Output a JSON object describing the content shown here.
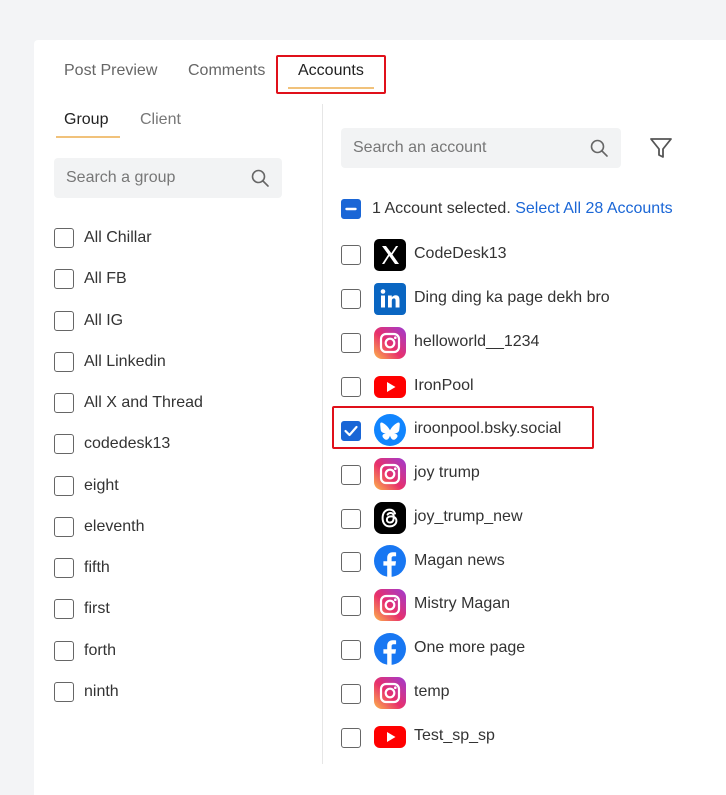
{
  "tabs": [
    {
      "label": "Post Preview"
    },
    {
      "label": "Comments"
    },
    {
      "label": "Accounts",
      "active": true
    }
  ],
  "subtabs": [
    {
      "label": "Group",
      "active": true
    },
    {
      "label": "Client"
    }
  ],
  "group_search": {
    "placeholder": "Search a group"
  },
  "groups": [
    {
      "label": "All Chillar"
    },
    {
      "label": "All FB"
    },
    {
      "label": "All IG"
    },
    {
      "label": "All Linkedin"
    },
    {
      "label": "All X and Thread"
    },
    {
      "label": "codedesk13"
    },
    {
      "label": "eight"
    },
    {
      "label": "eleventh"
    },
    {
      "label": "fifth"
    },
    {
      "label": "first"
    },
    {
      "label": "forth"
    },
    {
      "label": "ninth"
    }
  ],
  "account_search": {
    "placeholder": "Search an account"
  },
  "selection": {
    "summary": "1 Account selected.",
    "select_all": "Select All 28 Accounts"
  },
  "accounts": [
    {
      "name": "CodeDesk13",
      "platform": "x-icon",
      "checked": false
    },
    {
      "name": "Ding ding ka page dekh bro",
      "platform": "linkedin-icon",
      "checked": false
    },
    {
      "name": "helloworld__1234",
      "platform": "instagram-icon",
      "checked": false
    },
    {
      "name": "IronPool",
      "platform": "youtube-icon",
      "checked": false
    },
    {
      "name": "iroonpool.bsky.social",
      "platform": "bluesky-icon",
      "checked": true
    },
    {
      "name": "joy trump",
      "platform": "instagram-icon",
      "checked": false
    },
    {
      "name": "joy_trump_new",
      "platform": "threads-icon",
      "checked": false
    },
    {
      "name": "Magan news",
      "platform": "facebook-icon",
      "checked": false
    },
    {
      "name": "Mistry Magan",
      "platform": "instagram-icon",
      "checked": false
    },
    {
      "name": "One more page",
      "platform": "facebook-icon",
      "checked": false
    },
    {
      "name": "temp",
      "platform": "instagram-icon",
      "checked": false
    },
    {
      "name": "Test_sp_sp",
      "platform": "youtube-icon",
      "checked": false
    }
  ],
  "colors": {
    "accent": "#1a66d6",
    "tab_underline": "#f1c27b",
    "highlight": "#e0101a",
    "panel_bg": "#ffffff",
    "page_bg": "#f3f4f6"
  }
}
